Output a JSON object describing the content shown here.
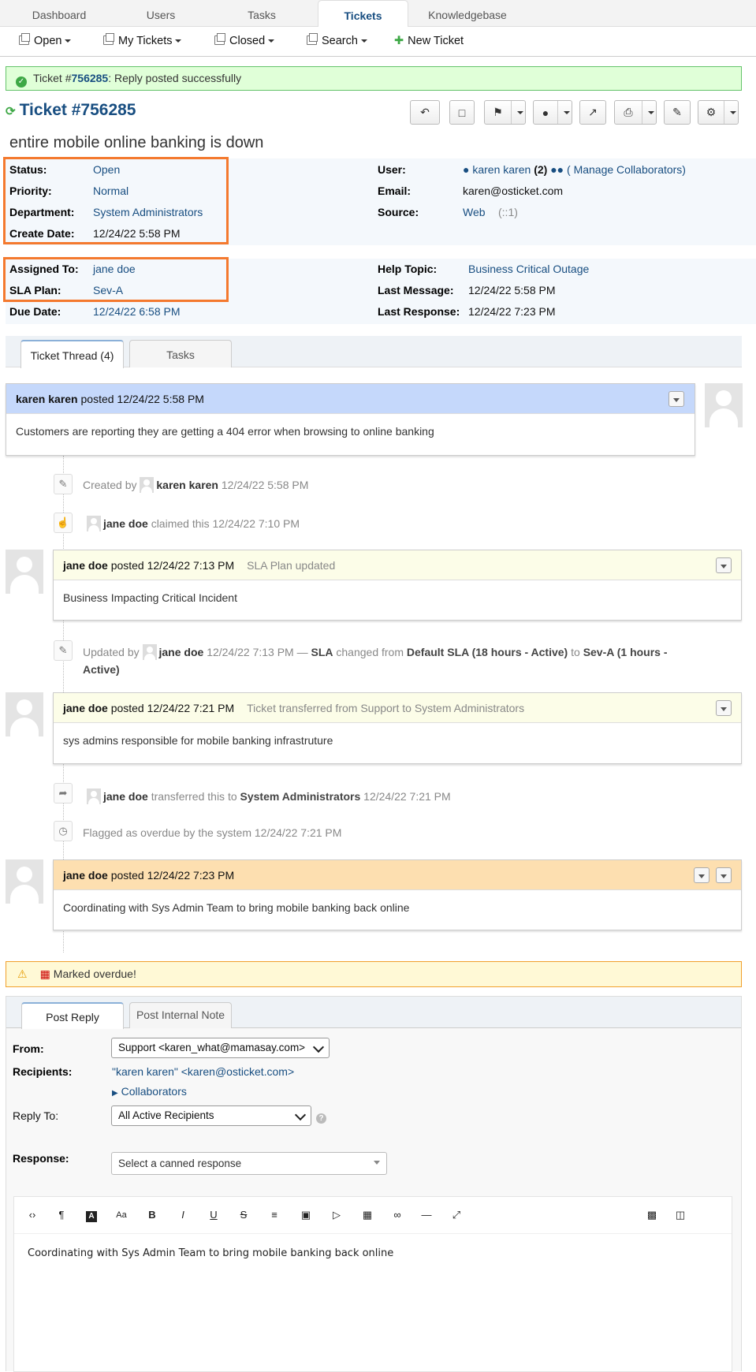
{
  "nav": {
    "tabs": [
      "Dashboard",
      "Users",
      "Tasks",
      "Tickets",
      "Knowledgebase"
    ],
    "active": "Tickets"
  },
  "subnav": {
    "open": "Open",
    "my_tickets": "My Tickets",
    "closed": "Closed",
    "search": "Search",
    "new_ticket": "New Ticket"
  },
  "banner": {
    "prefix": "Ticket #",
    "number": "756285",
    "suffix": ": Reply posted successfully"
  },
  "ticket": {
    "title": "Ticket #756285",
    "subject": "entire mobile online banking is down"
  },
  "info": {
    "status_label": "Status:",
    "status": "Open",
    "priority_label": "Priority:",
    "priority": "Normal",
    "department_label": "Department:",
    "department": "System Administrators",
    "create_label": "Create Date:",
    "create": "12/24/22 5:58 PM",
    "user_label": "User:",
    "user": "karen karen",
    "user_count": "(2)",
    "collab": "( Manage Collaborators)",
    "email_label": "Email:",
    "email": "karen@osticket.com",
    "source_label": "Source:",
    "source": "Web",
    "source_ip": "(::1)",
    "assigned_label": "Assigned To:",
    "assigned": "jane doe",
    "sla_label": "SLA Plan:",
    "sla": "Sev-A",
    "due_label": "Due Date:",
    "due": "12/24/22 6:58 PM",
    "topic_label": "Help Topic:",
    "topic": "Business Critical Outage",
    "lastmsg_label": "Last Message:",
    "lastmsg": "12/24/22 5:58 PM",
    "lastresp_label": "Last Response:",
    "lastresp": "12/24/22 7:23 PM"
  },
  "thread_tabs": [
    "Ticket Thread (4)",
    "Tasks"
  ],
  "thread": {
    "e1": {
      "author": "karen karen",
      "posted": "posted 12/24/22 5:58 PM",
      "body": "Customers are reporting they are getting a 404 error when browsing to online banking"
    },
    "ev1": {
      "pre": "Created by",
      "who": "karen karen",
      "time": "12/24/22 5:58 PM"
    },
    "ev2": {
      "who": "jane doe",
      "text": "claimed this 12/24/22 7:10 PM"
    },
    "e2": {
      "author": "jane doe",
      "posted": "posted 12/24/22 7:13 PM",
      "note": "SLA Plan updated",
      "body": "Business Impacting Critical Incident"
    },
    "ev3": {
      "pre": "Updated by",
      "who": "jane doe",
      "time": "12/24/22 7:13 PM —",
      "field": "SLA",
      "mid": "changed from",
      "from": "Default SLA (18 hours - Active)",
      "to_word": "to",
      "to": "Sev-A (1 hours - Active)"
    },
    "e3": {
      "author": "jane doe",
      "posted": "posted 12/24/22 7:21 PM",
      "note": "Ticket transferred from Support to System Administrators",
      "body": "sys admins responsible for mobile banking infrastruture"
    },
    "ev4": {
      "who": "jane doe",
      "text": "transferred this to",
      "dept": "System Administrators",
      "time": "12/24/22 7:21 PM"
    },
    "ev5": {
      "text": "Flagged as overdue by the system 12/24/22 7:21 PM"
    },
    "e4": {
      "author": "jane doe",
      "posted": "posted 12/24/22 7:23 PM",
      "body": "Coordinating with Sys Admin Team to bring mobile banking back online"
    }
  },
  "overdue": {
    "text": "Marked overdue!"
  },
  "reply": {
    "tabs": [
      "Post Reply",
      "Post Internal Note"
    ],
    "from_label": "From:",
    "from": "Support <karen_what@mamasay.com>",
    "recipients_label": "Recipients:",
    "recipients": "\"karen karen\" <karen@osticket.com>",
    "collaborators": "Collaborators",
    "replyto_label": "Reply To:",
    "replyto": "All Active Recipients",
    "response_label": "Response:",
    "canned": "Select a canned response",
    "editor_text": "Coordinating with Sys Admin Team to bring mobile banking back online"
  },
  "colors": {
    "link": "#184E81",
    "highlight": "#f4792e",
    "success_bg": "#e0ffd8",
    "overdue_bg": "#fff9d6"
  }
}
